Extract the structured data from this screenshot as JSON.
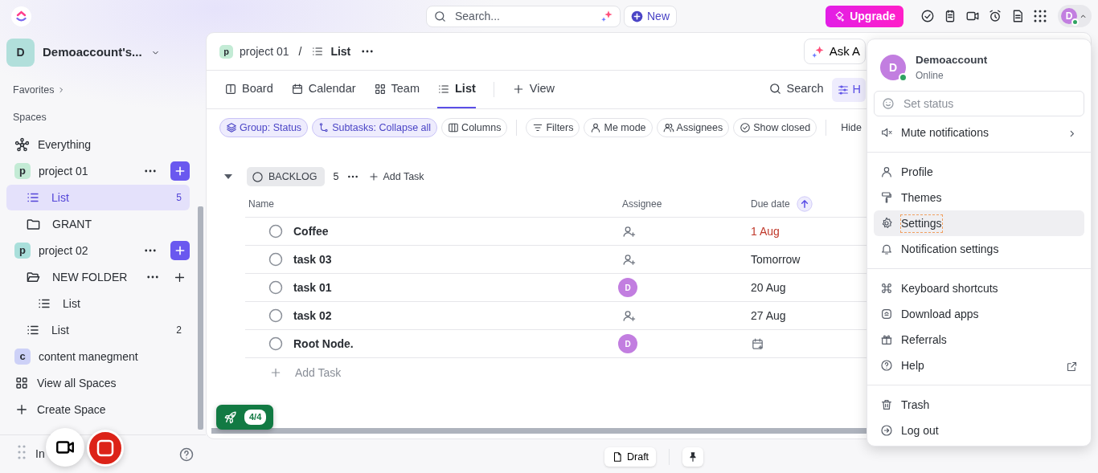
{
  "topbar": {
    "search": {
      "placeholder": "Search..."
    },
    "new_button": "New",
    "upgrade_button": "Upgrade",
    "avatar_initial": "D"
  },
  "sidebar": {
    "workspace": {
      "initial": "D",
      "name": "Demoaccount's..."
    },
    "favorites": "Favorites",
    "spaces_label": "Spaces",
    "items": [
      {
        "kind": "everything",
        "label": "Everything",
        "selected": false
      },
      {
        "kind": "space",
        "label": "project 01",
        "initial": "p",
        "color": "#c3ebd5",
        "show_actions": true,
        "selected": false,
        "children": [
          {
            "kind": "list",
            "label": "List",
            "count": "5",
            "selected": true
          },
          {
            "kind": "folder",
            "label": "GRANT",
            "expanded": false,
            "show_actions": false,
            "selected": false
          }
        ]
      },
      {
        "kind": "space",
        "label": "project 02",
        "initial": "p",
        "color": "#a9dfdb",
        "show_actions": true,
        "selected": false,
        "children": [
          {
            "kind": "folder",
            "label": "NEW FOLDER",
            "expanded": true,
            "show_actions": true,
            "selected": false,
            "children": [
              {
                "kind": "list",
                "label": "List",
                "selected": false
              }
            ]
          },
          {
            "kind": "list",
            "label": "List",
            "count": "2",
            "selected": false
          }
        ]
      },
      {
        "kind": "space",
        "label": "content manegment",
        "initial": "c",
        "color": "#cdd1f7",
        "show_actions": false,
        "selected": false
      },
      {
        "kind": "view_all",
        "label": "View all Spaces",
        "selected": false
      },
      {
        "kind": "create",
        "label": "Create Space",
        "selected": false
      }
    ],
    "footer_text": "In"
  },
  "main": {
    "breadcrumb": {
      "space_initial": "p",
      "space": "project 01",
      "separator": "/",
      "list": "List"
    },
    "ask_button": "Ask A",
    "views": [
      {
        "kind": "board",
        "label": "Board",
        "selected": false
      },
      {
        "kind": "calendar",
        "label": "Calendar",
        "selected": false
      },
      {
        "kind": "team",
        "label": "Team",
        "selected": false
      },
      {
        "kind": "list",
        "label": "List",
        "selected": true
      }
    ],
    "add_view": "View",
    "search": "Search",
    "h_button": "H",
    "chips": [
      {
        "kind": "group",
        "label": "Group: Status",
        "active": true
      },
      {
        "kind": "subtasks",
        "label": "Subtasks: Collapse all",
        "active": true
      },
      {
        "kind": "columns",
        "label": "Columns",
        "active": false
      },
      {
        "kind": "filters",
        "label": "Filters",
        "active": false
      },
      {
        "kind": "me",
        "label": "Me mode",
        "active": false
      },
      {
        "kind": "assignees",
        "label": "Assignees",
        "active": false
      },
      {
        "kind": "closed",
        "label": "Show closed",
        "active": false
      }
    ],
    "hide": "Hide",
    "group": {
      "status": "BACKLOG",
      "count": "5",
      "add_task": "Add Task",
      "expanded": true
    },
    "columns": [
      "Name",
      "Assignee",
      "Due date"
    ],
    "rows": [
      {
        "name": "Coffee",
        "due": "1 Aug",
        "overdue": true
      },
      {
        "name": "task 03",
        "due": "Tomorrow",
        "overdue": false
      },
      {
        "name": "task 01",
        "assignee": "D",
        "due": "20 Aug",
        "overdue": false
      },
      {
        "name": "task 02",
        "due": "27 Aug",
        "overdue": false
      },
      {
        "name": "Root Node.",
        "assignee": "D"
      }
    ],
    "add_task": "Add Task"
  },
  "rocket_badge": "4/4",
  "draft_button": "Draft",
  "menu": {
    "user": {
      "initial": "D",
      "name": "Demoaccount",
      "status": "Online"
    },
    "set_status": {
      "placeholder": "Set status"
    },
    "sections": [
      [
        {
          "kind": "mute",
          "label": "Mute notifications",
          "has_submenu": true,
          "selected": false
        }
      ],
      [
        {
          "kind": "profile",
          "label": "Profile",
          "selected": false
        },
        {
          "kind": "themes",
          "label": "Themes",
          "selected": false
        },
        {
          "kind": "settings",
          "label": "Settings",
          "selected": true
        },
        {
          "kind": "notifications",
          "label": "Notification settings",
          "selected": false
        }
      ],
      [
        {
          "kind": "shortcuts",
          "label": "Keyboard shortcuts",
          "selected": false
        },
        {
          "kind": "download",
          "label": "Download apps",
          "selected": false
        },
        {
          "kind": "referrals",
          "label": "Referrals",
          "selected": false
        },
        {
          "kind": "help",
          "label": "Help",
          "external": true,
          "selected": false
        }
      ],
      [
        {
          "kind": "trash",
          "label": "Trash",
          "selected": false
        },
        {
          "kind": "logout",
          "label": "Log out",
          "selected": false
        }
      ]
    ]
  }
}
